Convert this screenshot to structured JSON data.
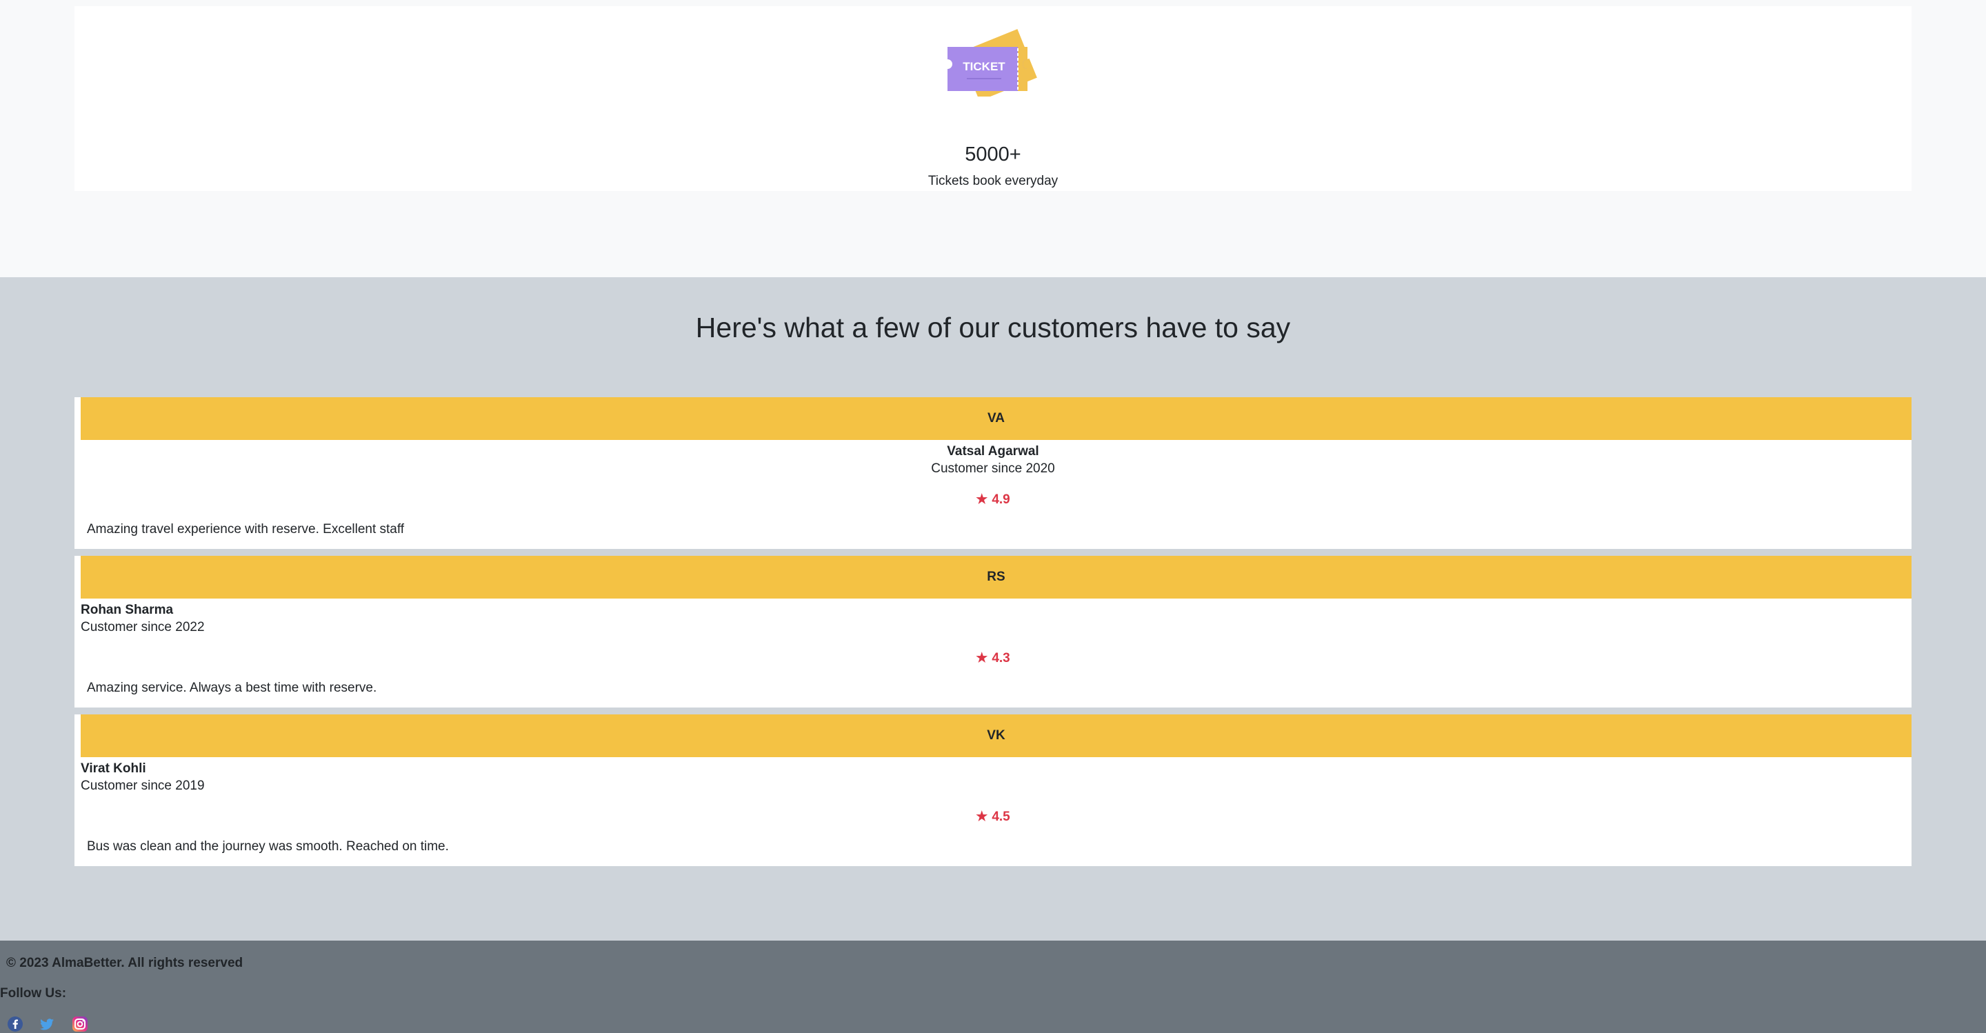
{
  "stats": {
    "icon": "ticket-icon",
    "icon_text": "TICKET",
    "value": "5000+",
    "label": "Tickets book everyday"
  },
  "testimonials": {
    "heading": "Here's what a few of our customers have to say",
    "items": [
      {
        "initials": "VA",
        "name": "Vatsal Agarwal",
        "since": "Customer since 2020",
        "rating": "4.9",
        "review": "Amazing travel experience with reserve. Excellent staff"
      },
      {
        "initials": "RS",
        "name": "Rohan Sharma",
        "since": "Customer since 2022",
        "rating": "4.3",
        "review": "Amazing service. Always a best time with reserve."
      },
      {
        "initials": "VK",
        "name": "Virat Kohli",
        "since": "Customer since 2019",
        "rating": "4.5",
        "review": "Bus was clean and the journey was smooth. Reached on time."
      }
    ]
  },
  "footer": {
    "copyright": "© 2023 AlmaBetter. All rights reserved",
    "follow_label": "Follow Us:",
    "social": [
      "facebook-icon",
      "twitter-icon",
      "instagram-icon"
    ]
  },
  "colors": {
    "accent": "#f4c244",
    "rating": "#dc3545",
    "testimonials_bg": "#ced4da",
    "footer_bg": "#6c757d"
  }
}
